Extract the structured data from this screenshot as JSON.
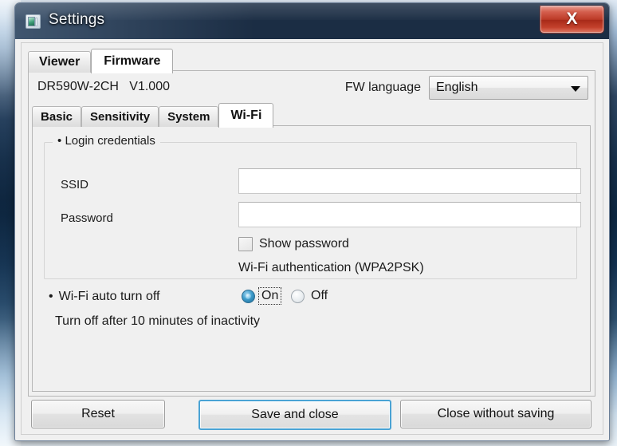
{
  "window": {
    "title": "Settings",
    "icon": "app-monitor-icon",
    "close_label": "X"
  },
  "tabs": [
    {
      "label": "Viewer",
      "active": false
    },
    {
      "label": "Firmware",
      "active": true
    }
  ],
  "firmware": {
    "model_version": "DR590W-2CH   V1.000",
    "language": {
      "label": "FW language",
      "selected": "English",
      "options": [
        "English"
      ]
    },
    "subtabs": [
      {
        "label": "Basic",
        "active": false
      },
      {
        "label": "Sensitivity",
        "active": false
      },
      {
        "label": "System",
        "active": false
      },
      {
        "label": "Wi-Fi",
        "active": true
      }
    ],
    "wifi": {
      "group_legend": "Login credentials",
      "ssid": {
        "label": "SSID",
        "value": "",
        "placeholder": ""
      },
      "password": {
        "label": "Password",
        "value": "",
        "placeholder": ""
      },
      "show_password": {
        "label": "Show password",
        "checked": false
      },
      "auth_text": "Wi-Fi authentication (WPA2PSK)",
      "auto_turn_off": {
        "label": "Wi-Fi auto turn off",
        "bullet": "•",
        "on_label": "On",
        "off_label": "Off",
        "selected": "On"
      },
      "inactivity_text": "Turn off after 10 minutes of inactivity"
    }
  },
  "buttons": {
    "reset": "Reset",
    "save_and_close": "Save and close",
    "close_without_saving": "Close without saving"
  },
  "colors": {
    "titlebar": "#1b2d44",
    "close_button": "#bc3a27",
    "default_button_border": "#4aa3d4",
    "radio_selected": "#2b7fad",
    "panel_bg": "#f0f0f0"
  }
}
